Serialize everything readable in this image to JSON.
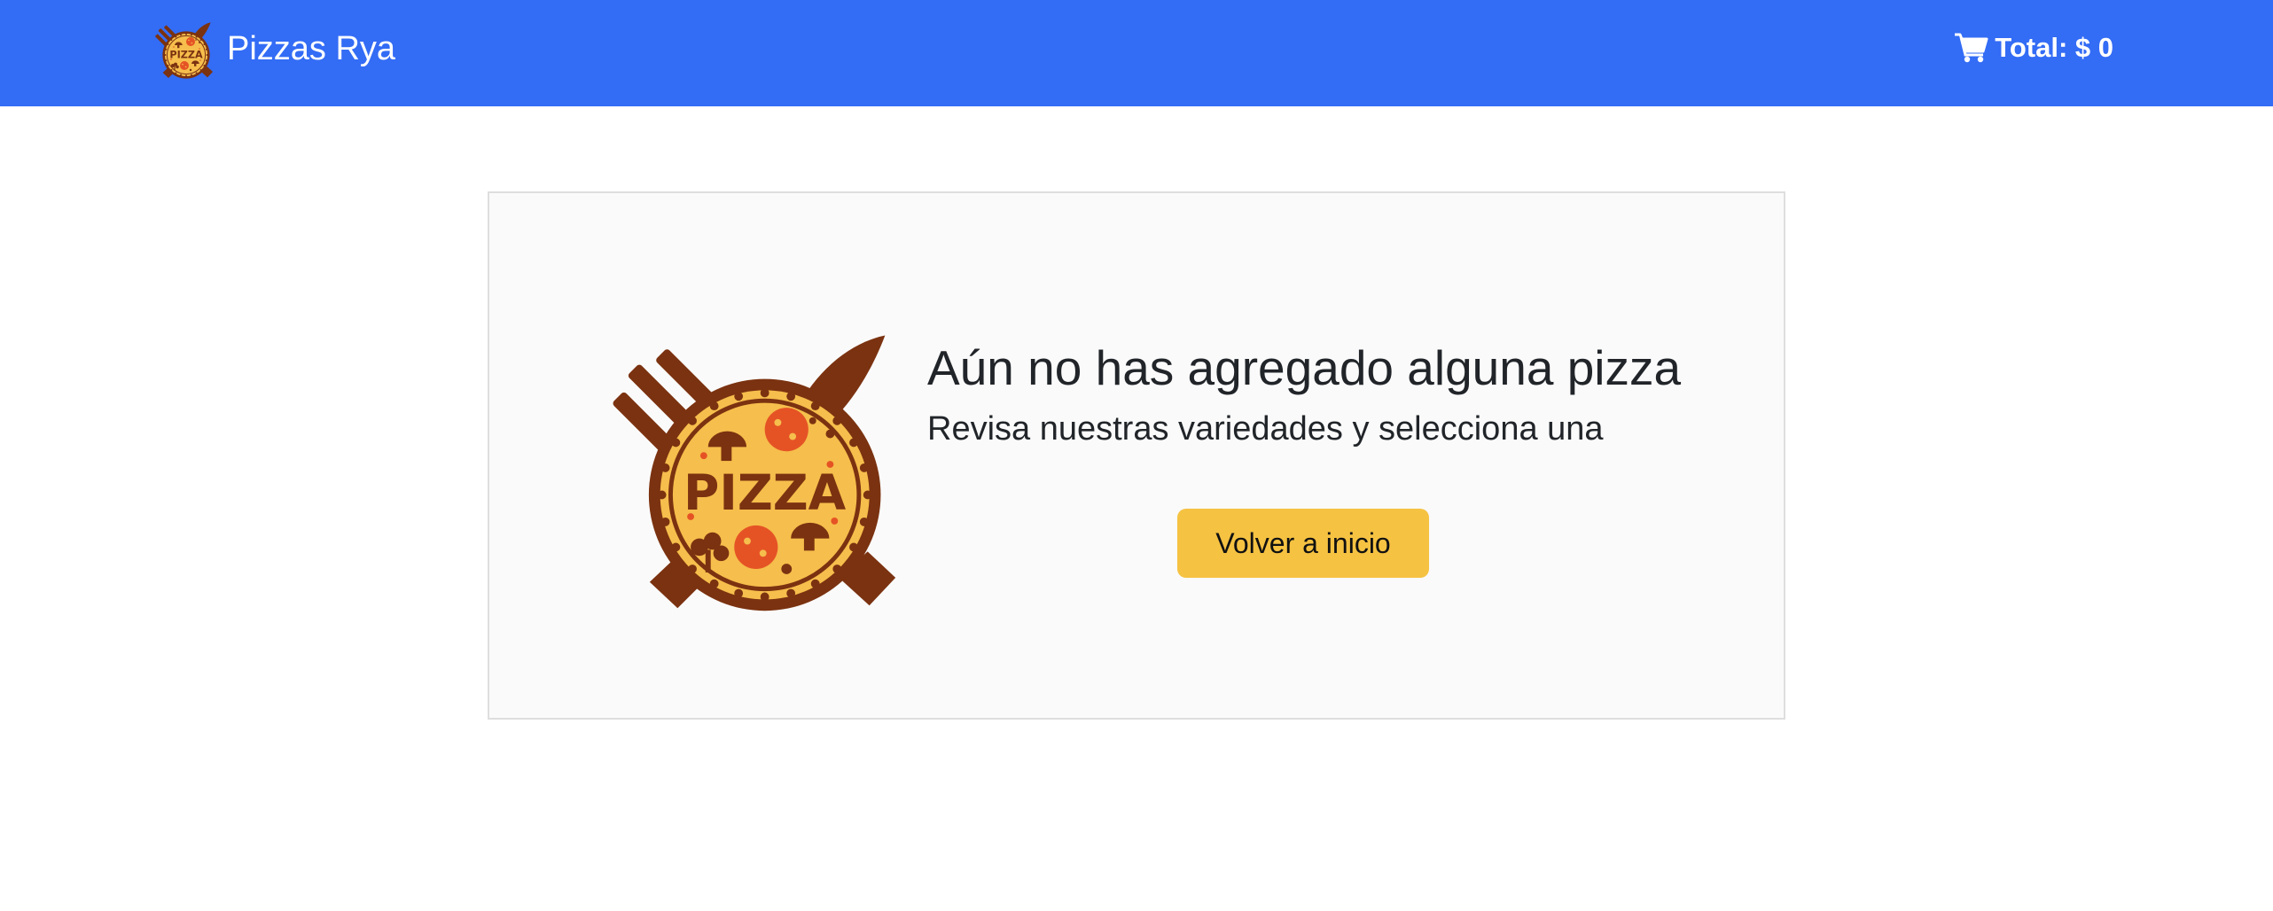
{
  "navbar": {
    "brand_name": "Pizzas Rya",
    "logo_icon": "pizza-logo-icon",
    "cart_icon": "shopping-cart-icon",
    "total_label": "Total: $ 0",
    "background_color": "#336cf5"
  },
  "empty_cart": {
    "image_icon": "pizza-logo-icon",
    "logo_text": "PIZZA",
    "title": "Aún no has agregado alguna pizza",
    "subtitle": "Revisa nuestras variedades y selecciona una",
    "button_label": "Volver a inicio",
    "button_color": "#f5c242"
  }
}
